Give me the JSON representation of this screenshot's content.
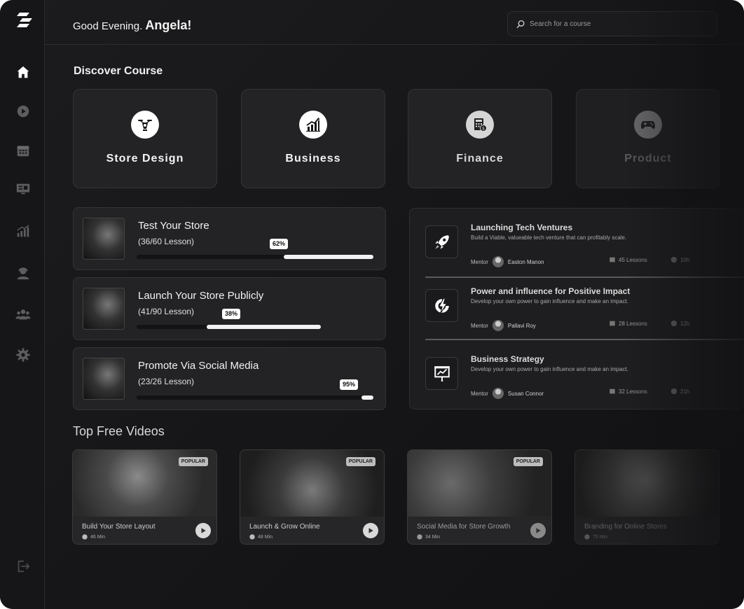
{
  "colors": {
    "background": "#151517",
    "card": "#232325",
    "accent": "#ffffff"
  },
  "header": {
    "greeting": "Good Evening.",
    "user_name": "Angela!",
    "search_placeholder": "Search for a course"
  },
  "sidebar": {
    "items": [
      {
        "icon": "home-icon"
      },
      {
        "icon": "play-icon"
      },
      {
        "icon": "calendar-icon"
      },
      {
        "icon": "monitor-icon"
      },
      {
        "icon": "chart-icon"
      },
      {
        "icon": "support-icon"
      },
      {
        "icon": "users-icon"
      },
      {
        "icon": "settings-icon"
      }
    ],
    "logout_icon": "logout-icon"
  },
  "discover": {
    "title": "Discover Course",
    "categories": [
      {
        "label": "Store Design",
        "icon": "drone-icon"
      },
      {
        "label": "Business",
        "icon": "growth-chart-icon"
      },
      {
        "label": "Finance",
        "icon": "calculator-icon"
      },
      {
        "label": "Product",
        "icon": "gamepad-icon"
      }
    ]
  },
  "progress": [
    {
      "title": "Test Your Store",
      "lessons": "(36/60 Lesson)",
      "percent_label": "62%",
      "percent": 62
    },
    {
      "title": "Launch Your Store Publicly",
      "lessons": "(41/90 Lesson)",
      "percent_label": "38%",
      "percent": 38
    },
    {
      "title": "Promote Via Social Media",
      "lessons": "(23/26 Lesson)",
      "percent_label": "95%",
      "percent": 95
    }
  ],
  "mentor_courses": [
    {
      "title": "Launching Tech Ventures",
      "desc": "Build a Viable, valueable tech venture that can profitably scale.",
      "mentor_label": "Mentor",
      "mentor": "Easton Manon",
      "lessons": "45 Lessons",
      "hours": "10h",
      "icon": "rocket-icon"
    },
    {
      "title": "Power and influence for Positive Impact",
      "desc": "Develop your own power to gain influence and make an impact.",
      "mentor_label": "Mentor",
      "mentor": "Pallavi Roy",
      "lessons": "28 Lessons",
      "hours": "12h",
      "icon": "lightning-icon"
    },
    {
      "title": "Business Strategy",
      "desc": "Develop your own power to gain influence and make an impact.",
      "mentor_label": "Mentor",
      "mentor": "Susan Connor",
      "lessons": "32 Lessons",
      "hours": "21h",
      "icon": "presentation-icon"
    }
  ],
  "videos": {
    "title": "Top Free Videos",
    "items": [
      {
        "title": "Build Your Store Layout",
        "duration": "46 Min",
        "badge": "POPULAR"
      },
      {
        "title": "Launch & Grow Online",
        "duration": "48 Min",
        "badge": "POPULAR"
      },
      {
        "title": "Social Media for Store Growth",
        "duration": "34 Min",
        "badge": "POPULAR"
      },
      {
        "title": "Branding for Online Stores",
        "duration": "75 Min",
        "badge": ""
      }
    ]
  }
}
